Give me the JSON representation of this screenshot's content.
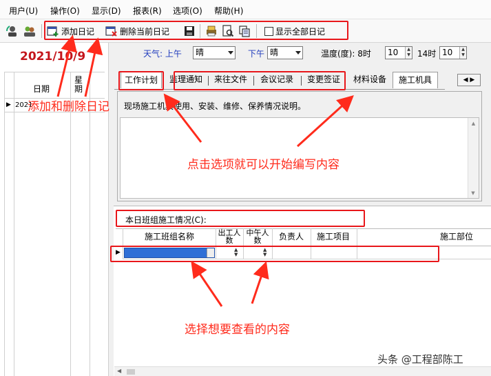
{
  "menubar": {
    "items": [
      "用户(U)",
      "操作(O)",
      "显示(D)",
      "报表(R)",
      "选项(O)",
      "帮助(H)"
    ]
  },
  "toolbar": {
    "add_diary": "添加日记",
    "delete_diary": "删除当前日记",
    "show_all_label": "显示全部日记",
    "show_all_checked": false
  },
  "left": {
    "date_title": "2021/10/9",
    "col_date": "日期",
    "col_week": "星期",
    "row_date": "2021"
  },
  "weather": {
    "label": "天气: 上午",
    "morning_value": "晴",
    "afternoon_label": "下午",
    "afternoon_value": "晴",
    "temp_label": "温度(度): 8时",
    "temp_8": "10",
    "label_14": "14时",
    "temp_14": "10"
  },
  "tabs": [
    "工作计划",
    "监理通知",
    "来往文件",
    "会议记录",
    "变更签证",
    "材料设备",
    "施工机具"
  ],
  "machinery_desc": "现场施工机具使用、安装、维修、保养情况说明。",
  "team_section": {
    "title": "本日班组施工情况(C):",
    "columns": [
      "施工班组名称",
      "出工人数",
      "中午人数",
      "负责人",
      "施工项目",
      "施工部位"
    ]
  },
  "annotations": {
    "add_delete": "添加和删除日记",
    "click_tab": "点击选项就可以开始编写内容",
    "select_content": "选择想要查看的内容"
  },
  "watermark": "头条 @工程部陈工",
  "colors": {
    "accent_red": "#e8161a",
    "date_red": "#c4161c",
    "blue_label": "#1f3bbd",
    "selection_blue": "#2f6fd6"
  }
}
